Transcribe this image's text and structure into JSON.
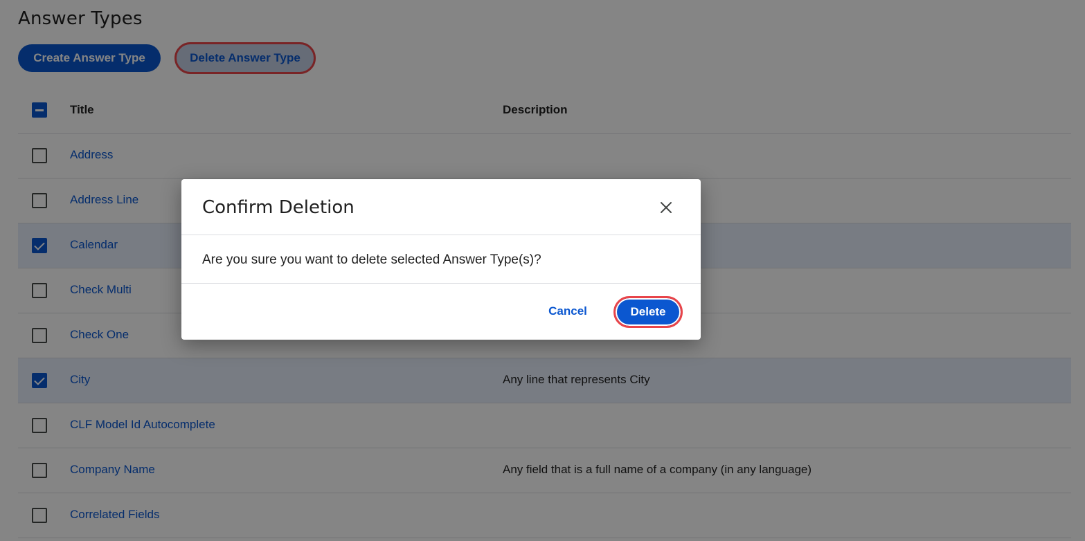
{
  "page": {
    "title": "Answer Types",
    "create_button": "Create Answer Type",
    "delete_button": "Delete Answer Type"
  },
  "table": {
    "header": {
      "title": "Title",
      "description": "Description",
      "select_all_state": "indeterminate"
    },
    "rows": [
      {
        "title": "Address",
        "description": "",
        "checked": false
      },
      {
        "title": "Address Line",
        "description": "",
        "checked": false
      },
      {
        "title": "Calendar",
        "description": "",
        "checked": true
      },
      {
        "title": "Check Multi",
        "description": "",
        "checked": false
      },
      {
        "title": "Check One",
        "description": "",
        "checked": false
      },
      {
        "title": "City",
        "description": "Any line that represents City",
        "checked": true
      },
      {
        "title": "CLF Model Id Autocomplete",
        "description": "",
        "checked": false
      },
      {
        "title": "Company Name",
        "description": "Any field that is a full name of a company (in any language)",
        "checked": false
      },
      {
        "title": "Correlated Fields",
        "description": "",
        "checked": false
      }
    ]
  },
  "dialog": {
    "title": "Confirm Deletion",
    "message": "Are you sure you want to delete selected Answer Type(s)?",
    "cancel_label": "Cancel",
    "confirm_label": "Delete",
    "close_icon": "close-icon"
  },
  "colors": {
    "primary": "#0b57d0",
    "highlight_outline": "#e8454a",
    "selected_row": "#e6eefc"
  }
}
